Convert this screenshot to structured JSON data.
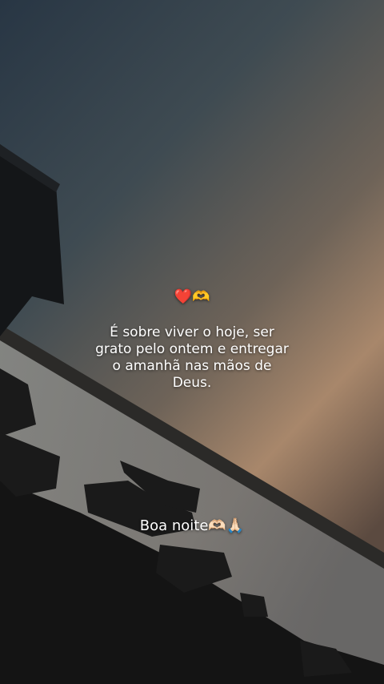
{
  "story": {
    "emoji_line": "❤️🫶",
    "quote": "É sobre viver o hoje, ser\ngrato pelo ontem e entregar\no amanhã nas mãos de\nDeus.",
    "greeting": "Boa noite🫶🏻🙏🏻"
  },
  "colors": {
    "sky_top": "#2a3946",
    "sky_mid": "#5a5a56",
    "horizon": "#b38a6a",
    "water": "#7c7a78",
    "foreground": "#141414"
  }
}
